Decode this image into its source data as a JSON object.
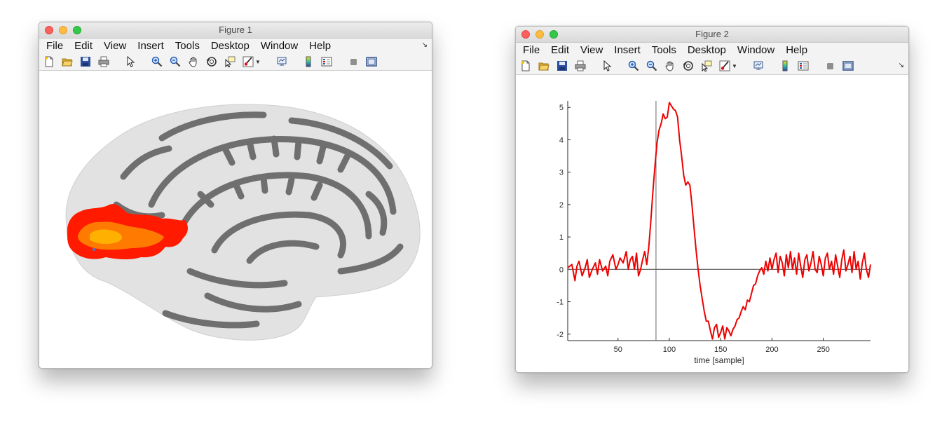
{
  "menu_items": [
    "File",
    "Edit",
    "View",
    "Insert",
    "Tools",
    "Desktop",
    "Window",
    "Help"
  ],
  "figure1": {
    "title": "Figure 1"
  },
  "figure2": {
    "title": "Figure 2",
    "chart_data": {
      "type": "line",
      "xlabel": "time [sample]",
      "ylabel": "",
      "xlim": [
        1,
        296
      ],
      "ylim": [
        -2.2,
        5.2
      ],
      "xticks": [
        50,
        100,
        150,
        200,
        250
      ],
      "yticks": [
        -2,
        -1,
        0,
        1,
        2,
        3,
        4,
        5
      ],
      "vline_x": 87,
      "hline_y": 0,
      "series_color": "#ee0000",
      "series": [
        {
          "x": [
            1,
            5,
            8,
            10,
            12,
            15,
            18,
            20,
            22,
            25,
            28,
            30,
            32,
            35,
            38,
            40,
            42,
            45,
            48,
            50,
            52,
            55,
            58,
            60,
            62,
            64,
            66,
            68,
            70,
            72,
            74,
            76,
            78,
            80,
            82,
            84,
            86,
            88,
            90,
            92,
            94,
            96,
            98,
            100,
            102,
            104,
            106,
            108,
            110,
            112,
            114,
            116,
            118,
            120,
            122,
            124,
            126,
            128,
            130,
            132,
            134,
            136,
            138,
            140,
            142,
            144,
            146,
            148,
            150,
            152,
            154,
            156,
            158,
            160,
            162,
            164,
            166,
            168,
            170,
            172,
            174,
            176,
            178,
            180,
            182,
            184,
            186,
            188,
            190,
            192,
            194,
            196,
            198,
            200,
            202,
            204,
            206,
            208,
            210,
            212,
            214,
            216,
            218,
            220,
            222,
            224,
            226,
            228,
            230,
            232,
            234,
            236,
            238,
            240,
            242,
            244,
            246,
            248,
            250,
            252,
            254,
            256,
            258,
            260,
            262,
            264,
            266,
            268,
            270,
            272,
            274,
            276,
            278,
            280,
            282,
            284,
            286,
            288,
            290,
            292,
            294,
            296
          ],
          "y": [
            0.05,
            0.15,
            -0.35,
            0.1,
            0.25,
            -0.2,
            0.05,
            0.3,
            -0.25,
            0.0,
            0.2,
            -0.15,
            0.3,
            -0.05,
            0.1,
            -0.2,
            0.25,
            0.45,
            0.0,
            0.15,
            0.35,
            0.2,
            0.55,
            0.0,
            0.3,
            0.4,
            0.0,
            0.5,
            -0.2,
            0.0,
            0.3,
            0.55,
            0.15,
            0.7,
            1.5,
            2.4,
            3.2,
            3.9,
            4.3,
            4.5,
            4.8,
            4.65,
            4.7,
            5.15,
            5.05,
            4.95,
            4.9,
            4.7,
            4.0,
            3.5,
            2.9,
            2.6,
            2.7,
            2.6,
            2.0,
            1.3,
            0.6,
            0.0,
            -0.5,
            -0.9,
            -1.3,
            -1.6,
            -1.6,
            -1.9,
            -2.15,
            -1.8,
            -1.7,
            -2.1,
            -1.95,
            -1.75,
            -2.15,
            -1.8,
            -1.9,
            -2.05,
            -1.85,
            -1.75,
            -1.55,
            -1.5,
            -1.3,
            -1.15,
            -1.25,
            -0.95,
            -1.0,
            -0.75,
            -0.5,
            -0.45,
            -0.2,
            -0.05,
            0.05,
            -0.15,
            0.25,
            -0.05,
            0.35,
            0.0,
            0.3,
            0.5,
            -0.1,
            0.4,
            0.2,
            -0.2,
            0.45,
            0.05,
            0.55,
            0.0,
            0.35,
            -0.15,
            0.5,
            0.1,
            -0.25,
            0.3,
            0.45,
            -0.05,
            0.2,
            0.55,
            0.0,
            -0.1,
            0.4,
            0.15,
            -0.2,
            0.35,
            0.5,
            0.0,
            0.25,
            -0.15,
            0.45,
            0.1,
            -0.25,
            0.3,
            0.6,
            -0.05,
            0.15,
            0.4,
            -0.1,
            0.55,
            0.0,
            0.25,
            -0.3,
            0.2,
            0.5,
            0.0,
            -0.25,
            0.15,
            0.5,
            0.05
          ]
        }
      ]
    }
  }
}
